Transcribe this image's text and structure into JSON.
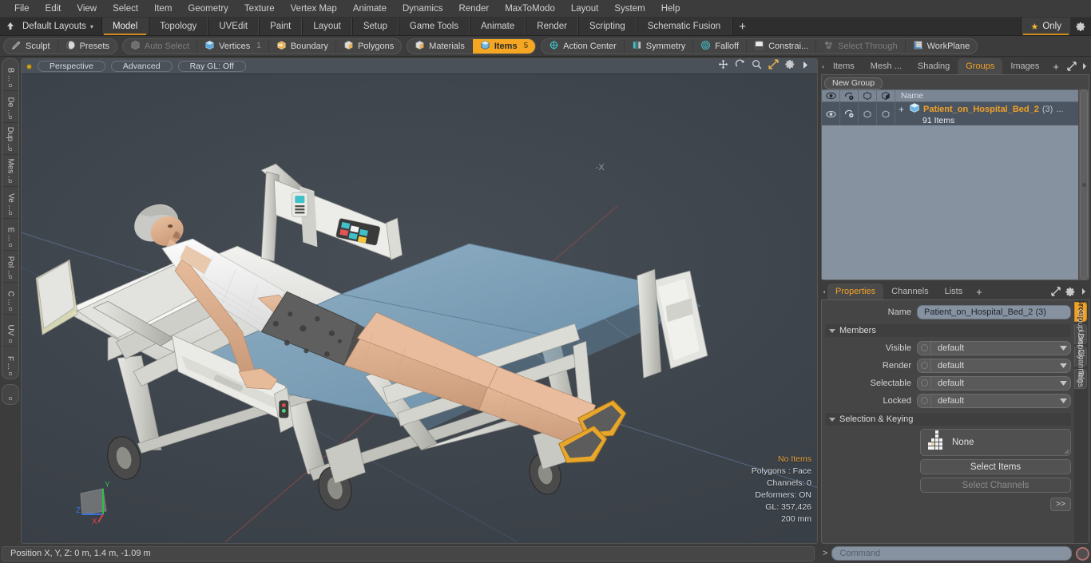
{
  "menubar": {
    "items": [
      "File",
      "Edit",
      "View",
      "Select",
      "Item",
      "Geometry",
      "Texture",
      "Vertex Map",
      "Animate",
      "Dynamics",
      "Render",
      "MaxToModo",
      "Layout",
      "System",
      "Help"
    ]
  },
  "layout_bar": {
    "home_icon": "home-arrow-icon",
    "layout_selector": "Default Layouts",
    "caret": "▾",
    "tabs": [
      {
        "label": "Model",
        "active": true
      },
      {
        "label": "Topology",
        "active": false
      },
      {
        "label": "UVEdit",
        "active": false
      },
      {
        "label": "Paint",
        "active": false
      },
      {
        "label": "Layout",
        "active": false
      },
      {
        "label": "Setup",
        "active": false
      },
      {
        "label": "Game Tools",
        "active": false
      },
      {
        "label": "Animate",
        "active": false
      },
      {
        "label": "Render",
        "active": false
      },
      {
        "label": "Scripting",
        "active": false
      },
      {
        "label": "Schematic Fusion",
        "active": false
      }
    ],
    "add_tab": "+",
    "only_label": "Only",
    "only_star": "★",
    "gear_icon": "gear-icon",
    "accent": "#d08a1e"
  },
  "modebar": {
    "left_group": [
      {
        "label": "Sculpt",
        "icon": "pen-icon",
        "state": "normal"
      },
      {
        "label": "Presets",
        "icon": "sphere-icon",
        "state": "normal"
      }
    ],
    "selection_group": [
      {
        "label": "Auto Select",
        "icon": "cube-grey-icon",
        "state": "dim",
        "num": ""
      },
      {
        "label": "Vertices",
        "icon": "cube-vertex-icon",
        "state": "normal",
        "num": "1"
      },
      {
        "label": "Boundary",
        "icon": "cube-boundary-icon",
        "state": "normal",
        "num": ""
      },
      {
        "label": "Polygons",
        "icon": "cube-polygon-icon",
        "state": "normal",
        "num": ""
      }
    ],
    "items_group": [
      {
        "label": "Materials",
        "icon": "cube-material-icon",
        "state": "normal",
        "num": ""
      },
      {
        "label": "Items",
        "icon": "cube-items-icon",
        "state": "selected",
        "num": "5"
      }
    ],
    "tools_group": [
      {
        "label": "Action Center",
        "icon": "action-center-icon",
        "state": "normal"
      },
      {
        "label": "Symmetry",
        "icon": "symmetry-icon",
        "state": "normal"
      },
      {
        "label": "Falloff",
        "icon": "falloff-icon",
        "state": "normal"
      },
      {
        "label": "Constrai...",
        "icon": "constraint-icon",
        "state": "normal"
      },
      {
        "label": "Select Through",
        "icon": "select-through-icon",
        "state": "dim"
      },
      {
        "label": "WorkPlane",
        "icon": "workplane-icon",
        "state": "normal"
      }
    ],
    "accent": "#f5a623"
  },
  "left_rail": {
    "items": [
      "B ...",
      "De ...",
      "Dup ...",
      "Mes ...",
      "Ve ...",
      "E ...",
      "Pol ...",
      "C ...",
      "UV",
      "F ..."
    ],
    "solo": "solo-toggle"
  },
  "viewport": {
    "dot": "viewport-state-dot",
    "pills": [
      "Perspective",
      "Advanced",
      "Ray GL: Off"
    ],
    "icons": [
      "move-icon",
      "rotate-icon",
      "zoom-icon",
      "fit-icon",
      "gear-icon",
      "chevron-right-icon"
    ],
    "stats": {
      "no_items": "No Items",
      "lines": [
        "Polygons : Face",
        "Channels: 0",
        "Deformers: ON",
        "GL: 357,426",
        "200 mm"
      ]
    },
    "gizmo": {
      "x": "X",
      "y": "Y",
      "z": "Z"
    },
    "scene_description": "Patient lying on hospital bed"
  },
  "right_panel": {
    "tabs": [
      {
        "label": "Items",
        "active": false
      },
      {
        "label": "Mesh ...",
        "active": false
      },
      {
        "label": "Shading",
        "active": false
      },
      {
        "label": "Groups",
        "active": true
      },
      {
        "label": "Images",
        "active": false
      }
    ],
    "add_tab": "+",
    "expand_icon": "expand-icon",
    "chevron_icon": "chevron-right-icon",
    "new_group_button": "New Group",
    "tree": {
      "column_icons": [
        "eye-icon",
        "render-icon",
        "cube-outline-icon",
        "cube-shade-icon"
      ],
      "name_column": "Name",
      "rows": [
        {
          "expander": "+",
          "icon": "group-cube-icon",
          "title": "Patient_on_Hospital_Bed_2",
          "count": "(3)",
          "dots": "...",
          "subtitle": "91 Items"
        }
      ]
    }
  },
  "properties": {
    "tabs": [
      {
        "label": "Properties",
        "active": true
      },
      {
        "label": "Channels",
        "active": false
      },
      {
        "label": "Lists",
        "active": false
      }
    ],
    "add_tab": "+",
    "expand_icon": "expand-icon",
    "gear_icon": "gear-icon",
    "chevron_icon": "chevron-right-icon",
    "name_label": "Name",
    "name_value": "Patient_on_Hospital_Bed_2 (3)",
    "members_section": "Members",
    "members_fields": [
      {
        "label": "Visible",
        "value": "default"
      },
      {
        "label": "Render",
        "value": "default"
      },
      {
        "label": "Selectable",
        "value": "default"
      },
      {
        "label": "Locked",
        "value": "default"
      }
    ],
    "selection_section": "Selection & Keying",
    "selection_preset": "None",
    "selection_preset_icon": "keying-grid-icon",
    "select_items_button": "Select Items",
    "select_channels_button": "Select Channels",
    "more_button": ">>",
    "side_tabs": [
      {
        "label": "Groups",
        "active": true
      },
      {
        "label": "Group Display",
        "active": false
      },
      {
        "label": "User Channels",
        "active": false
      },
      {
        "label": "Tags",
        "active": false
      }
    ]
  },
  "statusbar": {
    "position_text": "Position X, Y, Z:   0 m, 1.4 m, -1.09 m",
    "command_prompt": ">",
    "command_placeholder": "Command",
    "record_icon": "record-icon"
  }
}
